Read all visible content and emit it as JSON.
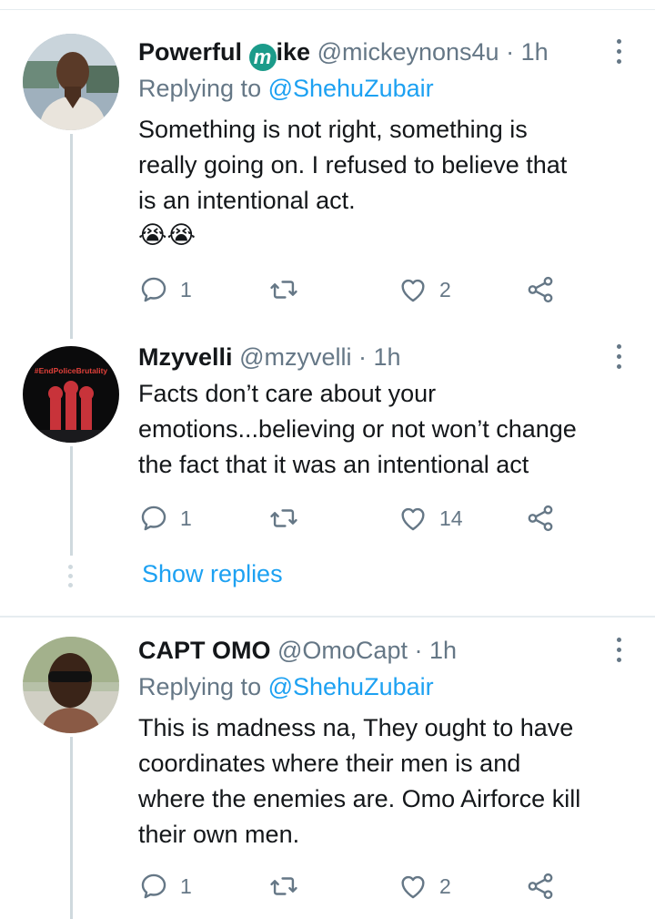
{
  "tweets": [
    {
      "name_prefix": "Powerful ",
      "name_badge": "m",
      "name_suffix": "ike",
      "handle": "@mickeynons4u",
      "dot": "·",
      "time": "1h",
      "replying_prefix": "Replying to ",
      "replying_to": "@ShehuZubair",
      "body_lines": [
        "Something is not right, something is",
        "really going on. I refused to believe that",
        "is an intentional act."
      ],
      "emojis": "😭😭",
      "reply_count": "1",
      "retweet_count": "",
      "like_count": "2"
    },
    {
      "name": "Mzyvelli",
      "handle": "@mzyvelli",
      "dot": "·",
      "time": "1h",
      "avatar_text": "#EndPoliceBrutality",
      "body_lines": [
        "Facts don’t care about your",
        "emotions...believing or not won’t change",
        "the fact that it was an intentional act"
      ],
      "reply_count": "1",
      "retweet_count": "",
      "like_count": "14"
    },
    {
      "name": "CAPT OMO",
      "handle": "@OmoCapt",
      "dot": "·",
      "time": "1h",
      "replying_prefix": "Replying to ",
      "replying_to": "@ShehuZubair",
      "body_lines": [
        "This is madness na, They ought to have",
        "coordinates where their men is and",
        "where the enemies are. Omo Airforce kill",
        "their own men."
      ],
      "reply_count": "1",
      "retweet_count": "",
      "like_count": "2"
    }
  ],
  "show_replies": "Show replies",
  "icons": {
    "reply": "reply-icon",
    "retweet": "retweet-icon",
    "like": "heart-icon",
    "share": "share-icon",
    "more": "more-vertical-icon"
  },
  "colors": {
    "link": "#1da1f2",
    "secondary": "#657786",
    "thread_line": "#cfd9de",
    "badge": "#1b9b8a"
  }
}
